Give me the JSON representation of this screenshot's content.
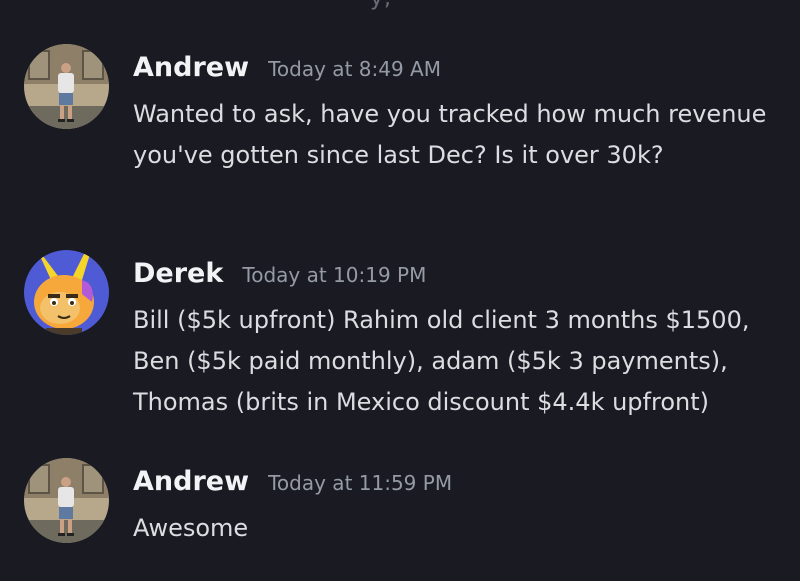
{
  "top_fragment": "... y, ...",
  "messages": [
    {
      "author": "Andrew",
      "timestamp": "Today at 8:49 AM",
      "avatar": "andrew-photo-avatar",
      "text": "Wanted to ask, have you tracked how much revenue you've gotten since last Dec? Is it over 30k?"
    },
    {
      "author": "Derek",
      "timestamp": "Today at 10:19 PM",
      "avatar": "cartoon-rabbit-avatar",
      "text": "Bill ($5k upfront) Rahim old client 3 months $1500, Ben ($5k paid monthly), adam ($5k 3 payments), Thomas (brits in Mexico discount $4.4k upfront)"
    },
    {
      "author": "Andrew",
      "timestamp": "Today at 11:59 PM",
      "avatar": "andrew-photo-avatar",
      "text": "Awesome"
    }
  ],
  "colors": {
    "background": "#1a1a23",
    "author": "#f2f3f5",
    "timestamp": "#949ba4",
    "message_text": "#dbdee1",
    "derek_avatar_bg": "#4f5bd5"
  }
}
